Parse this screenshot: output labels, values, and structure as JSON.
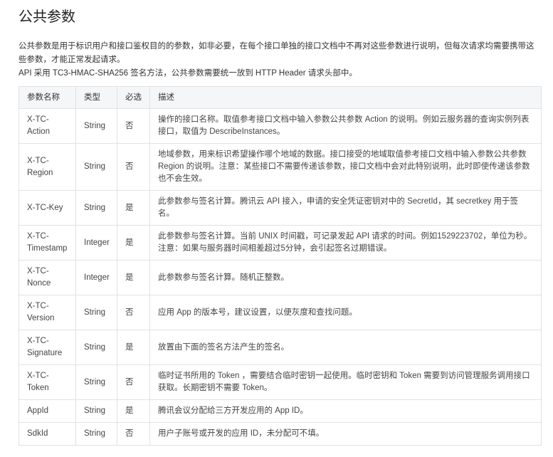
{
  "title": "公共参数",
  "intro": [
    "公共参数是用于标识用户和接口鉴权目的的参数，如非必要，在每个接口单独的接口文档中不再对这些参数进行说明，但每次请求均需要携带这些参数，才能正常发起请求。",
    "API 采用 TC3-HMAC-SHA256 签名方法，公共参数需要统一放到 HTTP Header 请求头部中。"
  ],
  "table": {
    "headers": [
      "参数名称",
      "类型",
      "必选",
      "描述"
    ],
    "rows": [
      {
        "name": "X-TC-Action",
        "type": "String",
        "required": "否",
        "desc": "操作的接口名称。取值参考接口文档中输入参数公共参数 Action 的说明。例如云服务器的查询实例列表接口，取值为 DescribeInstances。"
      },
      {
        "name": "X-TC-Region",
        "type": "String",
        "required": "否",
        "desc": "地域参数，用来标识希望操作哪个地域的数据。接口接受的地域取值参考接口文档中输入参数公共参数 Region 的说明。注意：某些接口不需要传递该参数，接口文档中会对此特别说明，此时即使传递该参数也不会生效。"
      },
      {
        "name": "X-TC-Key",
        "type": "String",
        "required": "是",
        "desc": "此参数参与签名计算。腾讯云 API 接入，申请的安全凭证密钥对中的 SecretId，其 secretkey 用于签名。"
      },
      {
        "name": "X-TC-Timestamp",
        "type": "Integer",
        "required": "是",
        "desc": "此参数参与签名计算。当前 UNIX 时间戳，可记录发起 API 请求的时间。例如1529223702，单位为秒。注意：如果与服务器时间相差超过5分钟，会引起签名过期错误。"
      },
      {
        "name": "X-TC-Nonce",
        "type": "Integer",
        "required": "是",
        "desc": "此参数参与签名计算。随机正整数。"
      },
      {
        "name": "X-TC-Version",
        "type": "String",
        "required": "否",
        "desc": "应用 App 的版本号，建议设置，以便灰度和查找问题。"
      },
      {
        "name": "X-TC-Signature",
        "type": "String",
        "required": "是",
        "desc": "放置由下面的签名方法产生的签名。"
      },
      {
        "name": "X-TC-Token",
        "type": "String",
        "required": "否",
        "desc": "临时证书所用的 Token ，需要结合临时密钥一起使用。临时密钥和 Token 需要到访问管理服务调用接口获取。长期密钥不需要 Token。"
      },
      {
        "name": "AppId",
        "type": "String",
        "required": "是",
        "desc": "腾讯会议分配给三方开发应用的 App ID。"
      },
      {
        "name": "SdkId",
        "type": "String",
        "required": "否",
        "desc": "用户子账号或开发的应用 ID，未分配可不填。"
      }
    ]
  }
}
